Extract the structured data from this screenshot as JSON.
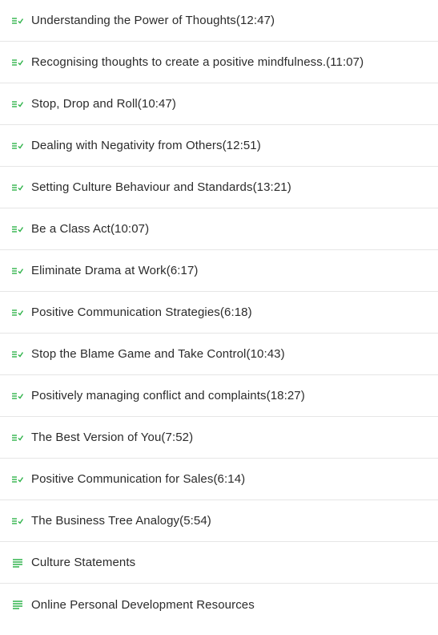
{
  "colors": {
    "accent": "#2fb34a",
    "text": "#2b2b2b",
    "divider": "#e6e6e6"
  },
  "lessons": [
    {
      "title": "Understanding the Power of Thoughts(12:47)",
      "icon": "video-check-icon"
    },
    {
      "title": "Recognising thoughts to create a positive mindfulness.(11:07)",
      "icon": "video-check-icon"
    },
    {
      "title": "Stop, Drop and Roll(10:47)",
      "icon": "video-check-icon"
    },
    {
      "title": "Dealing with Negativity from Others(12:51)",
      "icon": "video-check-icon"
    },
    {
      "title": "Setting Culture Behaviour and Standards(13:21)",
      "icon": "video-check-icon"
    },
    {
      "title": "Be a Class Act(10:07)",
      "icon": "video-check-icon"
    },
    {
      "title": "Eliminate Drama at Work(6:17)",
      "icon": "video-check-icon"
    },
    {
      "title": "Positive Communication Strategies(6:18)",
      "icon": "video-check-icon"
    },
    {
      "title": "Stop the Blame Game and Take Control(10:43)",
      "icon": "video-check-icon"
    },
    {
      "title": "Positively managing conflict and complaints(18:27)",
      "icon": "video-check-icon"
    },
    {
      "title": "The Best Version of You(7:52)",
      "icon": "video-check-icon"
    },
    {
      "title": "Positive Communication for Sales(6:14)",
      "icon": "video-check-icon"
    },
    {
      "title": "The Business Tree Analogy(5:54)",
      "icon": "video-check-icon"
    },
    {
      "title": "Culture Statements",
      "icon": "text-lines-icon"
    },
    {
      "title": "Online Personal Development Resources",
      "icon": "text-lines-icon"
    }
  ]
}
